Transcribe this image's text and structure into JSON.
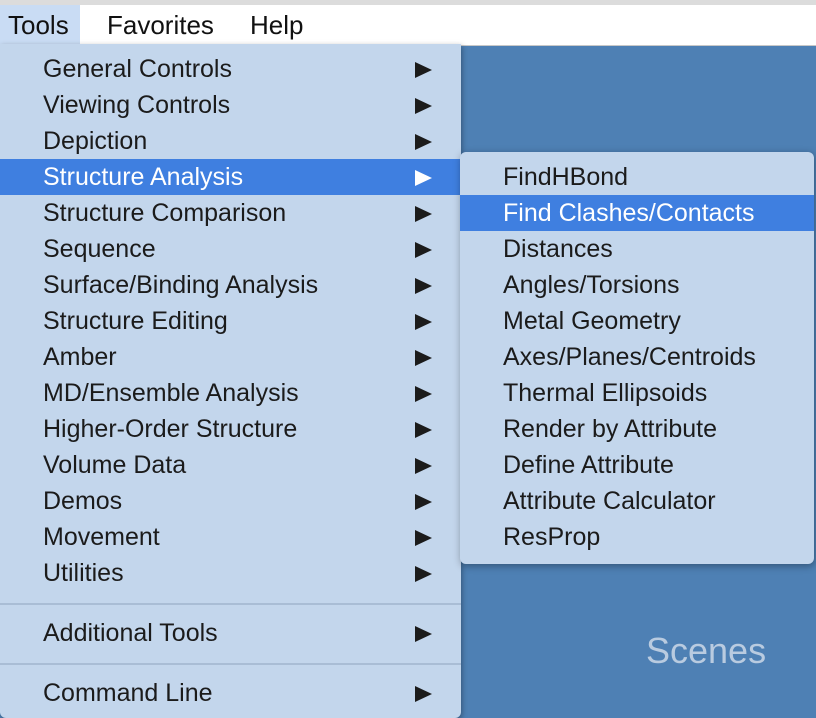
{
  "menubar": {
    "items": [
      {
        "label": "Tools",
        "active": true
      },
      {
        "label": "Favorites",
        "active": false
      },
      {
        "label": "Help",
        "active": false
      }
    ]
  },
  "background": {
    "scenes_label": "Scenes"
  },
  "tools_menu": {
    "items": [
      {
        "label": "General Controls",
        "has_submenu": true
      },
      {
        "label": "Viewing Controls",
        "has_submenu": true
      },
      {
        "label": "Depiction",
        "has_submenu": true
      },
      {
        "label": "Structure Analysis",
        "has_submenu": true,
        "selected": true
      },
      {
        "label": "Structure Comparison",
        "has_submenu": true
      },
      {
        "label": "Sequence",
        "has_submenu": true
      },
      {
        "label": "Surface/Binding Analysis",
        "has_submenu": true
      },
      {
        "label": "Structure Editing",
        "has_submenu": true
      },
      {
        "label": "Amber",
        "has_submenu": true
      },
      {
        "label": "MD/Ensemble Analysis",
        "has_submenu": true
      },
      {
        "label": "Higher-Order Structure",
        "has_submenu": true
      },
      {
        "label": "Volume Data",
        "has_submenu": true
      },
      {
        "label": "Demos",
        "has_submenu": true
      },
      {
        "label": "Movement",
        "has_submenu": true
      },
      {
        "label": "Utilities",
        "has_submenu": true
      }
    ],
    "additional_tools": {
      "label": "Additional Tools",
      "has_submenu": true
    },
    "command_line": {
      "label": "Command Line",
      "has_submenu": true
    }
  },
  "structure_analysis_submenu": {
    "items": [
      {
        "label": "FindHBond"
      },
      {
        "label": "Find Clashes/Contacts",
        "selected": true
      },
      {
        "label": "Distances"
      },
      {
        "label": "Angles/Torsions"
      },
      {
        "label": "Metal Geometry"
      },
      {
        "label": "Axes/Planes/Centroids"
      },
      {
        "label": "Thermal Ellipsoids"
      },
      {
        "label": "Render by Attribute"
      },
      {
        "label": "Define Attribute"
      },
      {
        "label": "Attribute Calculator"
      },
      {
        "label": "ResProp"
      }
    ]
  },
  "colors": {
    "menu_bg": "#c3d6ec",
    "selection": "#3f7fe0",
    "app_bg": "#4e80b4"
  }
}
